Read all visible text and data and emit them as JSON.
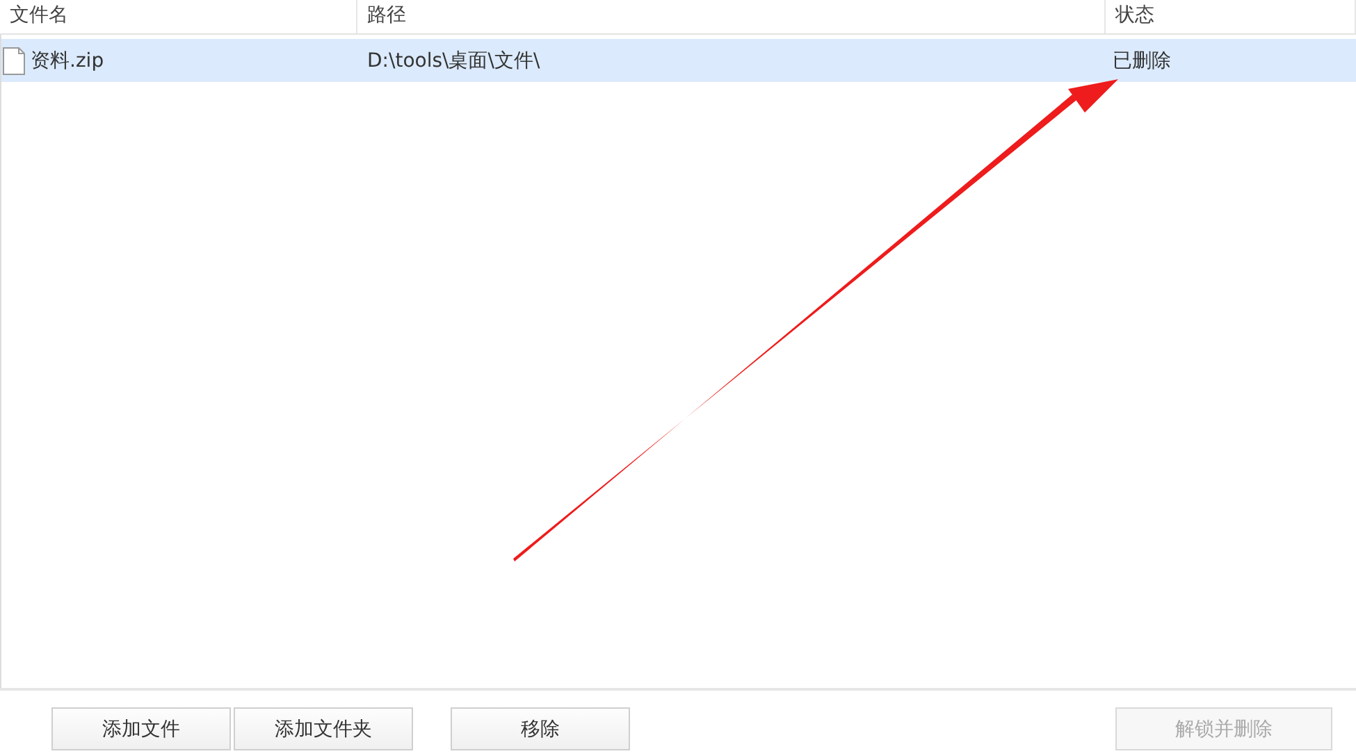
{
  "table": {
    "columns": [
      "文件名",
      "路径",
      "状态"
    ],
    "rows": [
      {
        "cells": [
          "资料.zip",
          "D:\\tools\\桌面\\文件\\",
          "已删除"
        ],
        "selected": true
      }
    ]
  },
  "annotation": {
    "kind": "arrow"
  },
  "buttons": [
    {
      "label": "添加文件",
      "disabled": false
    },
    {
      "label": "添加文件夹",
      "disabled": false
    },
    {
      "label": "移除",
      "disabled": false
    },
    {
      "label": "解锁并删除",
      "disabled": true
    }
  ]
}
